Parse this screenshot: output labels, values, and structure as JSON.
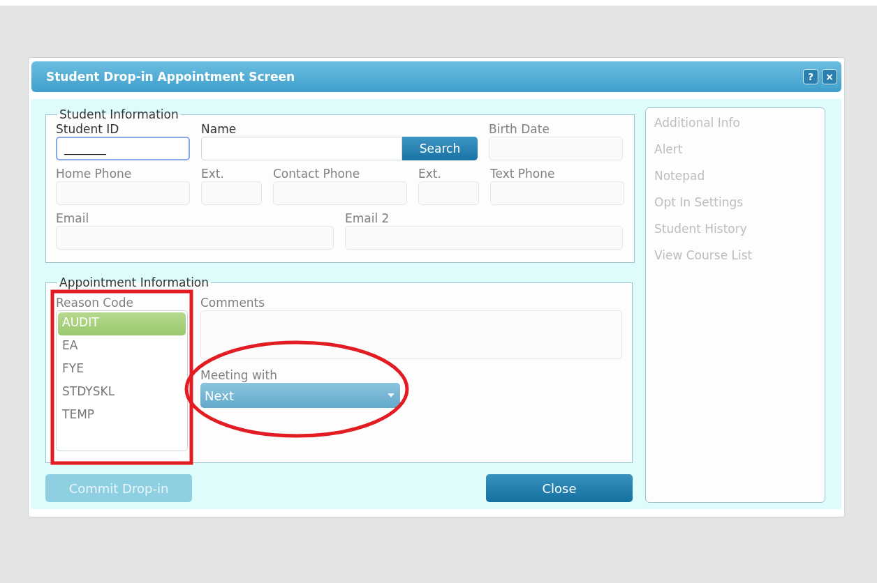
{
  "window": {
    "title": "Student Drop-in Appointment Screen",
    "help_button": "?",
    "close_button": "×"
  },
  "student_information": {
    "legend": "Student Information",
    "fields": [
      {
        "label": "Student ID",
        "value": "________",
        "focused": true,
        "disabled": false
      },
      {
        "label": "Name",
        "focused": false,
        "disabled": false,
        "button": "Search"
      },
      {
        "label": "Birth Date",
        "focused": false,
        "disabled": true
      },
      {
        "label": "Home Phone",
        "focused": false,
        "disabled": true
      },
      {
        "label": "Ext.",
        "focused": false,
        "disabled": true
      },
      {
        "label": "Contact Phone",
        "focused": false,
        "disabled": true
      },
      {
        "label": "Ext.",
        "focused": false,
        "disabled": true
      },
      {
        "label": "Text Phone",
        "focused": false,
        "disabled": true
      },
      {
        "label": "Email",
        "focused": false,
        "disabled": true
      },
      {
        "label": "Email 2",
        "focused": false,
        "disabled": true
      }
    ]
  },
  "appointment_information": {
    "legend": "Appointment Information",
    "reason_code": {
      "label": "Reason Code",
      "items": [
        {
          "label": "AUDIT",
          "selected": true
        },
        {
          "label": "EA",
          "selected": false
        },
        {
          "label": "FYE",
          "selected": false
        },
        {
          "label": "STDYSKL",
          "selected": false
        },
        {
          "label": "TEMP",
          "selected": false
        }
      ]
    },
    "comments": {
      "label": "Comments"
    },
    "meeting_with": {
      "label": "Meeting with",
      "value": "Next"
    }
  },
  "buttons": [
    {
      "label": "Commit Drop-in",
      "disabled": true
    },
    {
      "label": "Close",
      "disabled": false
    }
  ],
  "side_links": [
    {
      "label": "Additional Info",
      "disabled": true
    },
    {
      "label": "Alert",
      "disabled": true
    },
    {
      "label": "Notepad",
      "disabled": true
    },
    {
      "label": "Opt In Settings",
      "disabled": true
    },
    {
      "label": "Student History",
      "disabled": true
    },
    {
      "label": "View Course List",
      "disabled": true
    }
  ]
}
